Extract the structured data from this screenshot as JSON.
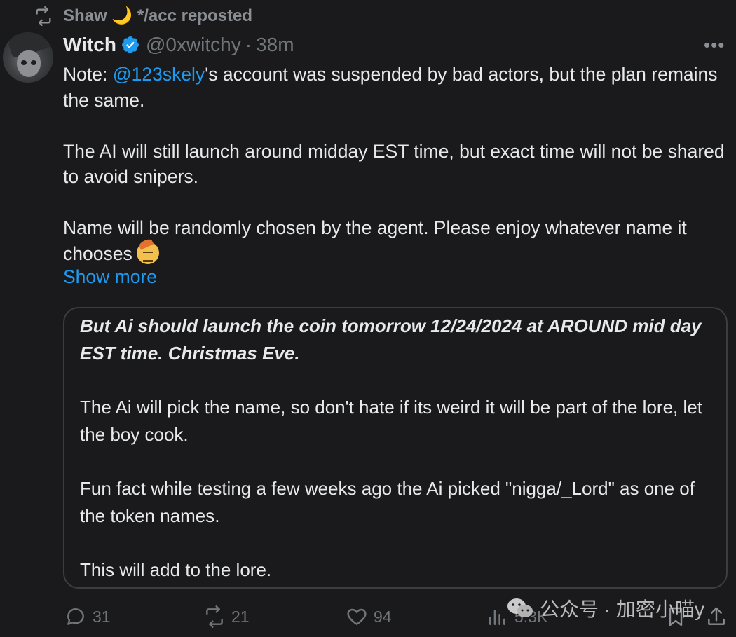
{
  "repost": {
    "reposter": "Shaw",
    "moon_emoji": "🌙",
    "suffix": "*/acc reposted",
    "icon": "repost-icon"
  },
  "author": {
    "display_name": "Witch",
    "verified": true,
    "handle": "@0xwitchy",
    "separator": "·",
    "time": "38m",
    "more_icon": "more-dots-icon",
    "more_label": "•••"
  },
  "tweet": {
    "line1_prefix": "Note: ",
    "mention": "@123skely",
    "line1_suffix": "'s account was suspended by bad actors, but the plan remains the same.",
    "para2": "The AI will still launch around midday EST time, but exact time will not be shared to avoid snipers.",
    "para3": "Name will be randomly chosen by the agent. Please enjoy whatever name it chooses",
    "emoji": "face-with-cowboy-hat-emoji",
    "show_more": "Show more"
  },
  "quote": {
    "para1": "But Ai should launch the coin tomorrow 12/24/2024 at AROUND mid day EST time. Christmas Eve.",
    "para2": "The Ai will pick the name, so don't hate if its weird it will be part of the lore, let the boy cook.",
    "para3": "Fun fact while testing a few weeks ago the Ai picked \"nigga/_Lord\" as one of the token names.",
    "para4": "This will add to the lore."
  },
  "actions": {
    "reply_count": "31",
    "repost_count": "21",
    "like_count": "94",
    "views_count": "5.3K"
  },
  "watermark": {
    "text": "公众号 · 加密小喵y",
    "icon": "wechat-logo"
  },
  "colors": {
    "background": "#1a1a1c",
    "text": "#e7e9ea",
    "muted": "#71767b",
    "accent": "#1d9bf0",
    "border": "#3a3d41"
  }
}
